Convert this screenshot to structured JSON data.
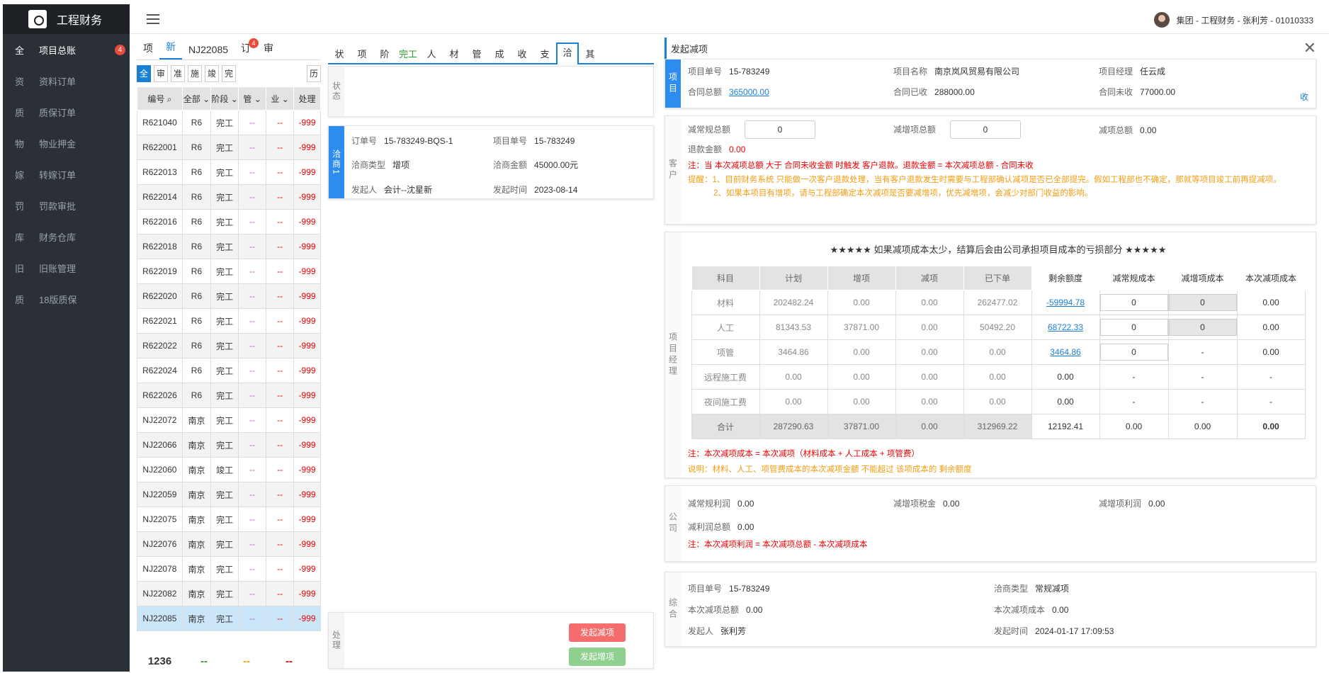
{
  "app": {
    "title": "工程财务"
  },
  "user": {
    "label": "集团 - 工程财务 - 张利芳 - 01010333"
  },
  "sidebar": {
    "items": [
      {
        "abbr": "全",
        "label": "项目总账",
        "badge": "4",
        "active": true
      },
      {
        "abbr": "资",
        "label": "资料订单"
      },
      {
        "abbr": "质",
        "label": "质保订单"
      },
      {
        "abbr": "物",
        "label": "物业押金"
      },
      {
        "abbr": "嫁",
        "label": "转嫁订单"
      },
      {
        "abbr": "罚",
        "label": "罚款审批"
      },
      {
        "abbr": "库",
        "label": "财务仓库"
      },
      {
        "abbr": "旧",
        "label": "旧账管理"
      },
      {
        "abbr": "质",
        "label": "18版质保"
      }
    ]
  },
  "list_panel": {
    "tabs": [
      "项",
      "新",
      "NJ22085",
      "订",
      "审"
    ],
    "tab_badge": "4",
    "filters": [
      "全",
      "审",
      "准",
      "施",
      "竣",
      "完"
    ],
    "history_btn": "历",
    "headers": [
      "编号",
      "全部",
      "阶段",
      "管",
      "业",
      "处理"
    ],
    "rows": [
      [
        "R621040",
        "R6",
        "完工",
        "--",
        "--",
        "-999"
      ],
      [
        "R622001",
        "R6",
        "完工",
        "--",
        "--",
        "-999"
      ],
      [
        "R622013",
        "R6",
        "完工",
        "--",
        "--",
        "-999"
      ],
      [
        "R622014",
        "R6",
        "完工",
        "--",
        "--",
        "-999"
      ],
      [
        "R622016",
        "R6",
        "完工",
        "--",
        "--",
        "-999"
      ],
      [
        "R622018",
        "R6",
        "完工",
        "--",
        "--",
        "-999"
      ],
      [
        "R622019",
        "R6",
        "完工",
        "--",
        "--",
        "-999"
      ],
      [
        "R622020",
        "R6",
        "完工",
        "--",
        "--",
        "-999"
      ],
      [
        "R622021",
        "R6",
        "完工",
        "--",
        "--",
        "-999"
      ],
      [
        "R622022",
        "R6",
        "完工",
        "--",
        "--",
        "-999"
      ],
      [
        "R622024",
        "R6",
        "完工",
        "--",
        "--",
        "-999"
      ],
      [
        "R622026",
        "R6",
        "完工",
        "--",
        "--",
        "-999"
      ],
      [
        "NJ22072",
        "南京",
        "完工",
        "--",
        "--",
        "-999"
      ],
      [
        "NJ22066",
        "南京",
        "完工",
        "--",
        "--",
        "-999"
      ],
      [
        "NJ22060",
        "南京",
        "竣工",
        "--",
        "--",
        "-999"
      ],
      [
        "NJ22059",
        "南京",
        "完工",
        "--",
        "--",
        "-999"
      ],
      [
        "NJ22075",
        "南京",
        "完工",
        "--",
        "--",
        "-999"
      ],
      [
        "NJ22076",
        "南京",
        "完工",
        "--",
        "--",
        "-999"
      ],
      [
        "NJ22078",
        "南京",
        "完工",
        "--",
        "--",
        "-999"
      ],
      [
        "NJ22082",
        "南京",
        "完工",
        "--",
        "--",
        "-999"
      ],
      [
        "NJ22085",
        "南京",
        "完工",
        "--",
        "--",
        "-999"
      ]
    ],
    "footer": {
      "count": "1236",
      "c1": "--",
      "c2": "--",
      "c3": "--"
    }
  },
  "detail_panel": {
    "tabs": [
      "状",
      "项",
      "阶",
      "完工",
      "人",
      "材",
      "管",
      "成",
      "收",
      "支",
      "洽",
      "其"
    ],
    "status_label": "状态",
    "card": {
      "side": "洽商1",
      "order_no_label": "订单号",
      "order_no": "15-783249-BQS-1",
      "proj_no_label": "项目单号",
      "proj_no": "15-783249",
      "type_label": "洽商类型",
      "type": "增项",
      "amount_label": "洽商金额",
      "amount": "45000.00元",
      "initiator_label": "发起人",
      "initiator": "会计--沈星新",
      "time_label": "发起时间",
      "time": "2023-08-14"
    },
    "process_label": "处理",
    "btn_reduce": "发起减项",
    "btn_add": "发起增项"
  },
  "reduce_panel": {
    "title": "发起减项",
    "project": {
      "side": "项目",
      "proj_no_label": "项目单号",
      "proj_no": "15-783249",
      "name_label": "项目名称",
      "name": "南京岚风贸易有限公司",
      "manager_label": "项目经理",
      "manager": "任云成",
      "total_label": "合同总额",
      "total": "365000.00",
      "received_label": "合同已收",
      "received": "288000.00",
      "unreceived_label": "合同未收",
      "unreceived": "77000.00",
      "collapse": "收"
    },
    "customer": {
      "side": "客户",
      "normal_total_label": "减常规总额",
      "normal_total": "0",
      "inc_total_label": "减增项总额",
      "inc_total": "0",
      "reduce_total_label": "减项总额",
      "reduce_total": "0.00",
      "refund_label": "退款金额",
      "refund": "0.00",
      "note1": "注：当 本次减项总额 大于 合同未收金额 时触发 客户退款。退款金额 = 本次减项总额 - 合同未收",
      "tip1": "提醒：1、目前财务系统 只能做一次客户退款处理，当有客户退款发生时需要与工程部确认减项是否已全部提完。假如工程部也不确定，那就等项目竣工前再提减项。",
      "tip2": "2、如果本项目有增项，请与工程部确定本次减项是否要减增项，优先减增项，会减少对部门收益的影响。"
    },
    "manager": {
      "side": "项目经理",
      "warning": "★★★★★ 如果减项成本太少，结算后会由公司承担项目成本的亏损部分 ★★★★★",
      "headers": [
        "科目",
        "计划",
        "增项",
        "减项",
        "已下单",
        "剩余额度",
        "减常规成本",
        "减增项成本",
        "本次减项成本"
      ],
      "rows": [
        {
          "name": "材料",
          "plan": "202482.24",
          "inc": "0.00",
          "dec": "0.00",
          "ordered": "262477.02",
          "remain": "-59994.78",
          "rn": "0",
          "ri": "0",
          "cur": "0.00",
          "link": true,
          "type": "both"
        },
        {
          "name": "人工",
          "plan": "81343.53",
          "inc": "37871.00",
          "dec": "0.00",
          "ordered": "50492.20",
          "remain": "68722.33",
          "rn": "0",
          "ri": "0",
          "cur": "0.00",
          "link": true,
          "type": "both"
        },
        {
          "name": "项管",
          "plan": "3464.86",
          "inc": "0.00",
          "dec": "0.00",
          "ordered": "0.00",
          "remain": "3464.86",
          "rn": "0",
          "ri": "-",
          "cur": "0.00",
          "link": true,
          "type": "one"
        },
        {
          "name": "远程施工费",
          "plan": "0.00",
          "inc": "0.00",
          "dec": "0.00",
          "ordered": "0.00",
          "remain": "0.00",
          "rn": "-",
          "ri": "-",
          "cur": "-",
          "link": false,
          "type": "none"
        },
        {
          "name": "夜间施工费",
          "plan": "0.00",
          "inc": "0.00",
          "dec": "0.00",
          "ordered": "0.00",
          "remain": "0.00",
          "rn": "-",
          "ri": "-",
          "cur": "-",
          "link": false,
          "type": "none"
        }
      ],
      "sum": [
        "合计",
        "287290.63",
        "37871.00",
        "0.00",
        "312969.22",
        "12192.41",
        "0.00",
        "0.00",
        "0.00"
      ],
      "note": "注：本次减项成本 = 本次减项（材料成本 + 人工成本 + 项管费）",
      "explain": "说明：材料、人工、项管费成本的本次减项金额 不能超过 该项成本的 剩余额度"
    },
    "company": {
      "side": "公司",
      "normal_profit_label": "减常规利润",
      "normal_profit": "0.00",
      "inc_tax_label": "减增项税金",
      "inc_tax": "0.00",
      "inc_profit_label": "减增项利润",
      "inc_profit": "0.00",
      "profit_total_label": "减利润总额",
      "profit_total": "0.00",
      "note": "注：本次减项利润 = 本次减项总额 - 本次减项成本"
    },
    "summary": {
      "side": "综合",
      "proj_no_label": "项目单号",
      "proj_no": "15-783249",
      "type_label": "洽商类型",
      "type": "常规减项",
      "total_label": "本次减项总额",
      "total": "0.00",
      "cost_label": "本次减项成本",
      "cost": "0.00",
      "initiator_label": "发起人",
      "initiator": "张利芳",
      "time_label": "发起时间",
      "time": "2024-01-17 17:09:53"
    }
  }
}
